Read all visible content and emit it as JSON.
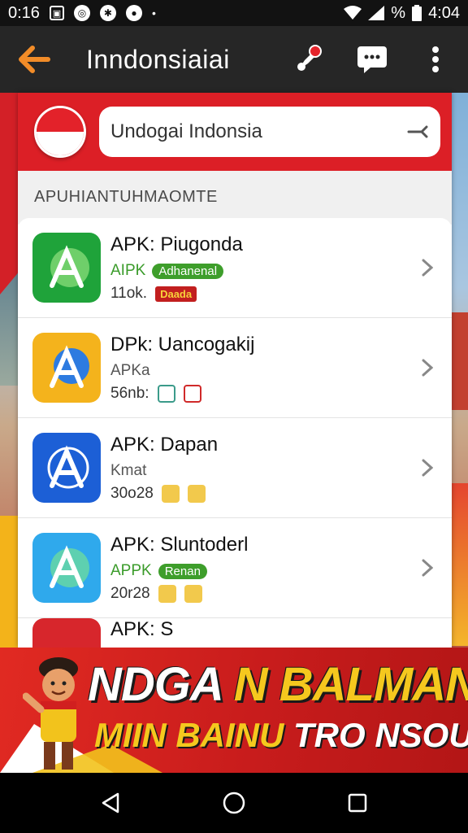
{
  "status_bar": {
    "time_left": "0:16",
    "battery_text": "%",
    "time_right": "4:04"
  },
  "app_bar": {
    "title": "Inndonsiaiai"
  },
  "search": {
    "value": "Undogai Indonsia"
  },
  "section": {
    "label": "APUHIANTUHMAOMTE"
  },
  "apps": [
    {
      "name": "APK: Piugonda",
      "meta": "AIPK",
      "tag": "Adhanenal",
      "size": "11ok.",
      "badge": "Daada",
      "icon_color": "#1fa33a"
    },
    {
      "name": "DPk: Uancogakij",
      "meta": "APKa",
      "tag": "",
      "size": "56nb:",
      "badge": "",
      "icon_color": "#f4b31c"
    },
    {
      "name": "APK: Dapan",
      "meta": "Kmat",
      "tag": "",
      "size": "30o28",
      "badge": "",
      "icon_color": "#1c5fd6"
    },
    {
      "name": "APK: Sluntoderl",
      "meta": "APPK",
      "tag": "Renan",
      "size": "20r28",
      "badge": "",
      "icon_color": "#2fa9ec"
    }
  ],
  "peek_app": {
    "name": "APK: S"
  },
  "promo": {
    "title_white": "NDGA",
    "title_yellow": "N BALMAN",
    "sub_yellow": "MIIN BAINU",
    "sub_white": "TRO NSOUS."
  },
  "colors": {
    "red": "#dc1f26",
    "yellow": "#f5c81e",
    "green": "#3e9e2b"
  }
}
